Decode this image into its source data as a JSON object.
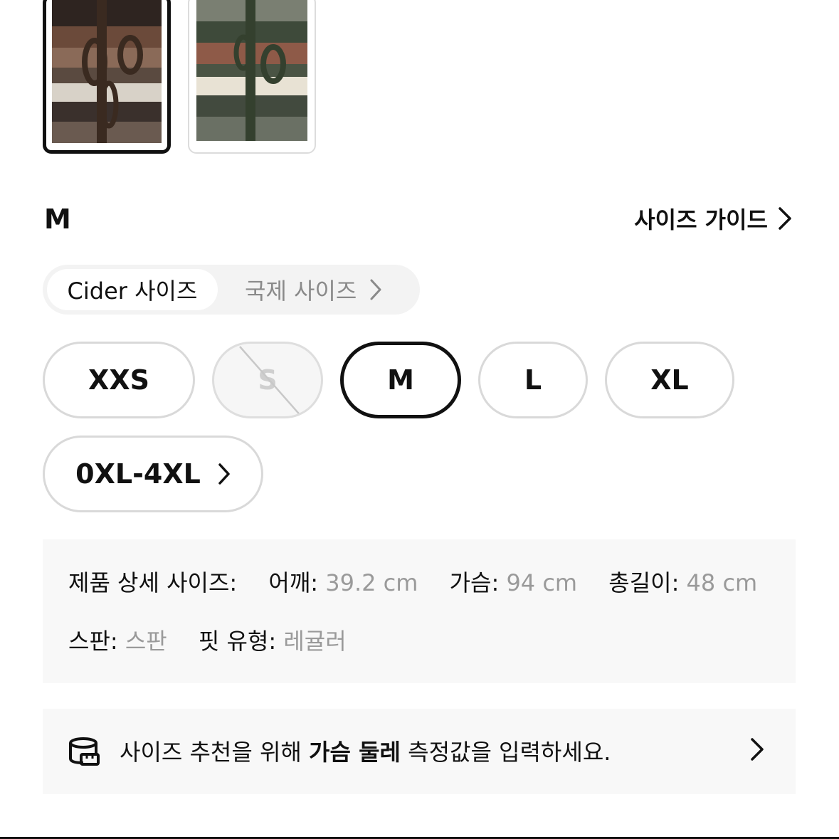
{
  "thumbnails": [
    {
      "name": "thumbnail-brown",
      "selected": true
    },
    {
      "name": "thumbnail-green",
      "selected": false
    }
  ],
  "selected_size_label": "M",
  "size_guide": {
    "label": "사이즈 가이드",
    "icon": "chevron-right-icon"
  },
  "size_system": {
    "active_label": "Cider 사이즈",
    "inactive_label": "국제 사이즈",
    "inactive_icon": "chevron-right-icon"
  },
  "sizes": {
    "xxs": "XXS",
    "s": "S",
    "m": "M",
    "l": "L",
    "xl": "XL",
    "plus": "0XL-4XL"
  },
  "details": {
    "title": "제품 상세 사이즈:",
    "shoulder_label": "어깨:",
    "shoulder_value": "39.2 cm",
    "chest_label": "가슴:",
    "chest_value": "94 cm",
    "length_label": "총길이:",
    "length_value": "48 cm",
    "stretch_label": "스판:",
    "stretch_value": "스판",
    "fit_label": "핏 유형:",
    "fit_value": "레귤러"
  },
  "recommendation": {
    "icon": "tape-measure-icon",
    "text_before": "사이즈 추천을 위해 ",
    "text_bold": "가슴 둘레",
    "text_after": " 측정값을 입력하세요."
  }
}
